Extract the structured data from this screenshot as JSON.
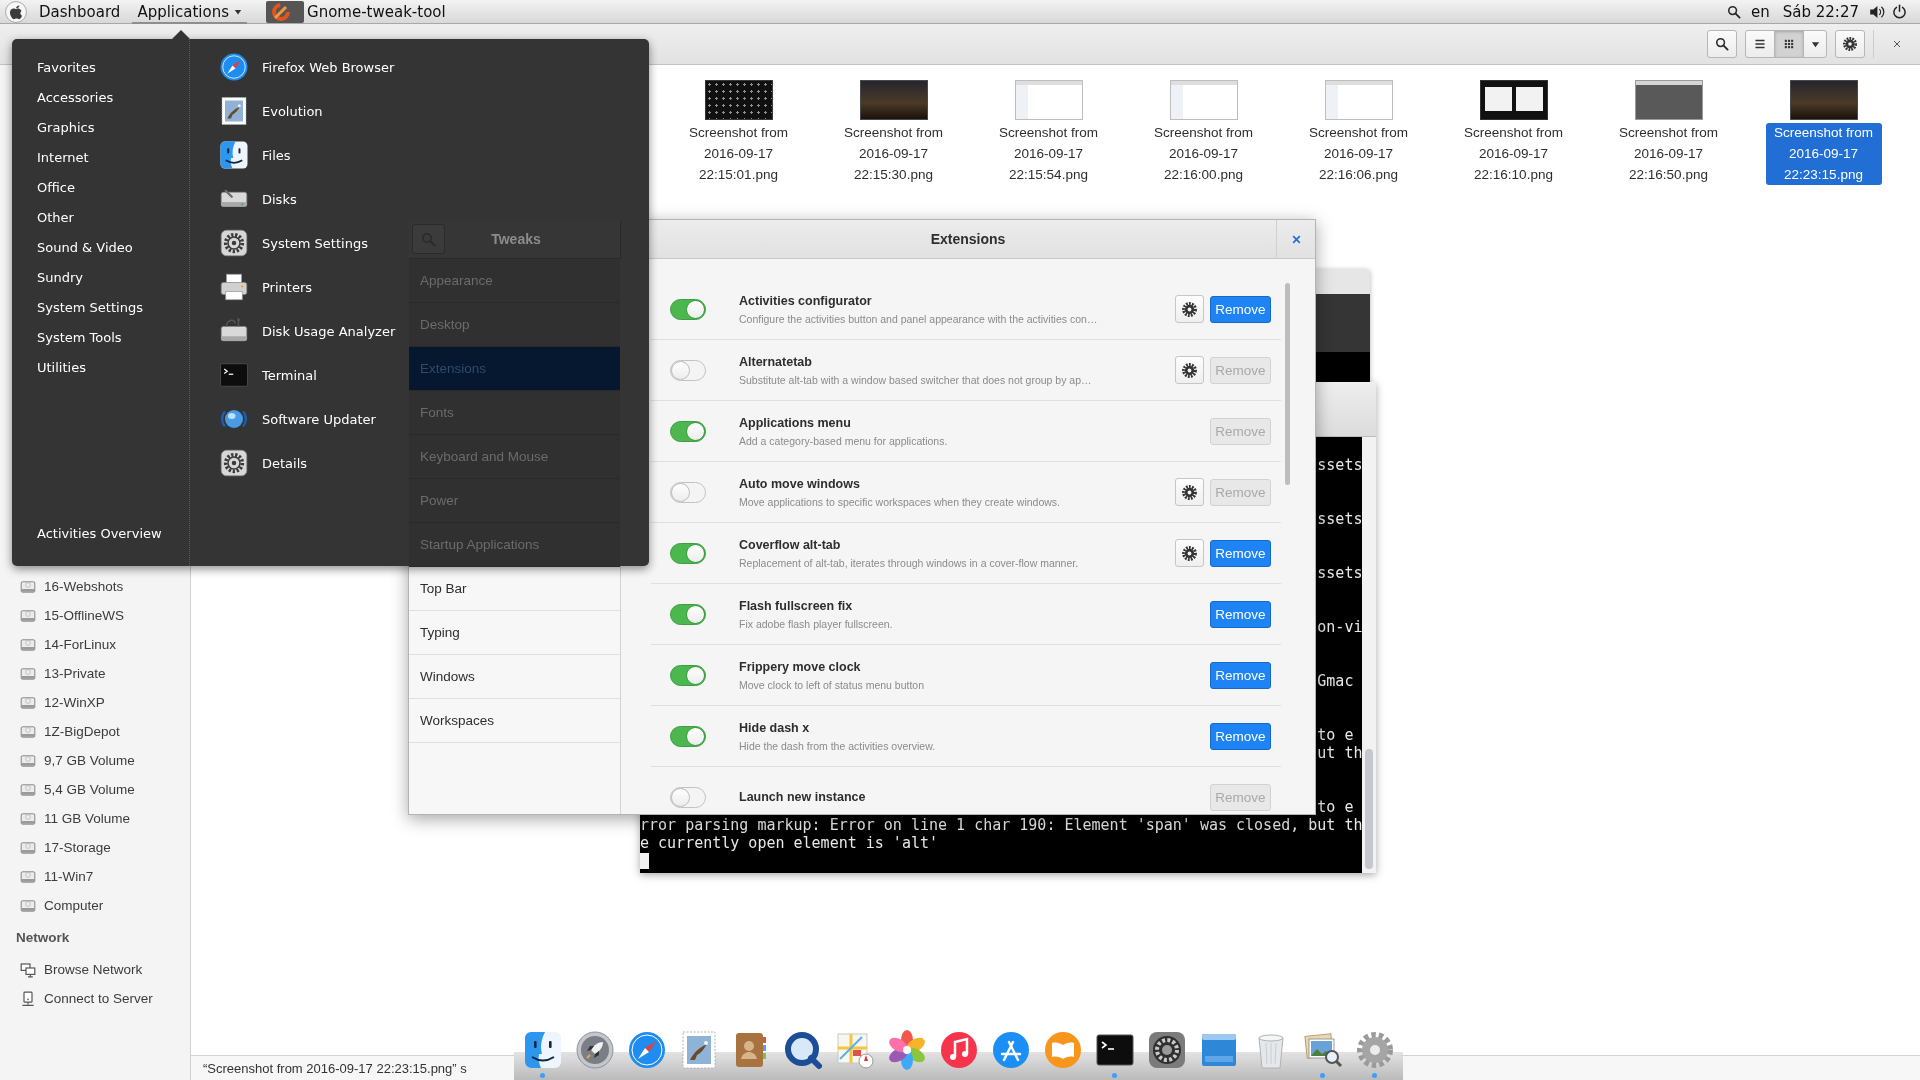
{
  "top_bar": {
    "menus": [
      {
        "label": "Dashboard",
        "selected": false,
        "dropdown": false
      },
      {
        "label": "Applications",
        "selected": true,
        "dropdown": true
      }
    ],
    "window_title": "Gnome-tweak-tool",
    "language": "en",
    "clock": "Sáb 22:27"
  },
  "app_menu": {
    "categories": [
      "Favorites",
      "Accessories",
      "Graphics",
      "Internet",
      "Office",
      "Other",
      "Sound & Video",
      "Sundry",
      "System Settings",
      "System Tools",
      "Utilities"
    ],
    "apps": [
      {
        "label": "Firefox Web Browser",
        "kind": "compass"
      },
      {
        "label": "Evolution",
        "kind": "stamp"
      },
      {
        "label": "Files",
        "kind": "face"
      },
      {
        "label": "Disks",
        "kind": "disk"
      },
      {
        "label": "System Settings",
        "kind": "gear"
      },
      {
        "label": "Printers",
        "kind": "printer"
      },
      {
        "label": "Disk Usage Analyzer",
        "kind": "analyzer"
      },
      {
        "label": "Terminal",
        "kind": "terminal"
      },
      {
        "label": "Software Updater",
        "kind": "globe"
      },
      {
        "label": "Details",
        "kind": "gear"
      }
    ],
    "footer": "Activities Overview"
  },
  "file_manager": {
    "view_buttons": [
      {
        "kind": "list",
        "selected": false
      },
      {
        "kind": "grid",
        "selected": true
      }
    ],
    "devices": [
      "16-Webshots",
      "15-OfflineWS",
      "14-ForLinux",
      "13-Private",
      "12-WinXP",
      "1Z-BigDepot",
      "9,7 GB Volume",
      "5,4 GB Volume",
      "11 GB Volume",
      "17-Storage",
      "11-Win7",
      "Computer"
    ],
    "network_title": "Network",
    "network": [
      {
        "label": "Browse Network",
        "kind": "network"
      },
      {
        "label": "Connect to Server",
        "kind": "server"
      }
    ],
    "files": [
      {
        "name": "Screenshot from 2016-09-17 22:15:01.png",
        "kind": "dark",
        "selected": false
      },
      {
        "name": "Screenshot from 2016-09-17 22:15:30.png",
        "kind": "photo",
        "selected": false
      },
      {
        "name": "Screenshot from 2016-09-17 22:15:54.png",
        "kind": "light",
        "selected": false
      },
      {
        "name": "Screenshot from 2016-09-17 22:16:00.png",
        "kind": "light",
        "selected": false
      },
      {
        "name": "Screenshot from 2016-09-17 22:16:06.png",
        "kind": "light",
        "selected": false
      },
      {
        "name": "Screenshot from 2016-09-17 22:16:10.png",
        "kind": "split",
        "selected": false
      },
      {
        "name": "Screenshot from 2016-09-17 22:16:50.png",
        "kind": "grey",
        "selected": false
      },
      {
        "name": "Screenshot from 2016-09-17 22:23:15.png",
        "kind": "photo",
        "selected": true
      }
    ],
    "status": "“Screenshot from 2016-09-17 22:23:15.png” s"
  },
  "tweak_tool": {
    "sidebar_header": {
      "title": "Tweaks",
      "shaded": true
    },
    "sidebar": [
      {
        "label": "Appearance",
        "selected": false,
        "shaded": true
      },
      {
        "label": "Desktop",
        "selected": false,
        "shaded": true
      },
      {
        "label": "Extensions",
        "selected": true,
        "shaded": true
      },
      {
        "label": "Fonts",
        "selected": false,
        "shaded": true
      },
      {
        "label": "Keyboard and Mouse",
        "selected": false,
        "shaded": true
      },
      {
        "label": "Power",
        "selected": false,
        "shaded": true
      },
      {
        "label": "Startup Applications",
        "selected": false,
        "shaded": true
      },
      {
        "label": "Top Bar",
        "selected": false,
        "shaded": false
      },
      {
        "label": "Typing",
        "selected": false,
        "shaded": false
      },
      {
        "label": "Windows",
        "selected": false,
        "shaded": false
      },
      {
        "label": "Workspaces",
        "selected": false,
        "shaded": false
      }
    ],
    "title": "Extensions",
    "extensions": [
      {
        "name": "Activities configurator",
        "description": "Configure the activities button and panel appearance with the activities con…",
        "enabled": true,
        "settings": true,
        "remove": {
          "label": "Remove",
          "disabled": false
        }
      },
      {
        "name": "Alternatetab",
        "description": "Substitute alt-tab with a window based switcher that does not group by ap…",
        "enabled": false,
        "settings": true,
        "remove": {
          "label": "Remove",
          "disabled": true
        }
      },
      {
        "name": "Applications menu",
        "description": "Add a category-based menu for applications.",
        "enabled": true,
        "settings": false,
        "remove": {
          "label": "Remove",
          "disabled": true
        }
      },
      {
        "name": "Auto move windows",
        "description": "Move applications to specific workspaces when they create windows.",
        "enabled": false,
        "settings": true,
        "remove": {
          "label": "Remove",
          "disabled": true
        }
      },
      {
        "name": "Coverflow alt-tab",
        "description": "Replacement of alt-tab, iterates through windows in a cover-flow manner.",
        "enabled": true,
        "settings": true,
        "remove": {
          "label": "Remove",
          "disabled": false
        }
      },
      {
        "name": "Flash fullscreen fix",
        "description": "Fix adobe flash player fullscreen.",
        "enabled": true,
        "settings": false,
        "remove": {
          "label": "Remove",
          "disabled": false
        }
      },
      {
        "name": "Frippery move clock",
        "description": "Move clock to left of status menu button",
        "enabled": true,
        "settings": false,
        "remove": {
          "label": "Remove",
          "disabled": false
        }
      },
      {
        "name": "Hide dash x",
        "description": "Hide the dash from the activities overview.",
        "enabled": true,
        "settings": false,
        "remove": {
          "label": "Remove",
          "disabled": false
        }
      },
      {
        "name": "Launch new instance",
        "enabled": false,
        "settings": false,
        "remove": {
          "label": "Remove",
          "disabled": true
        }
      }
    ]
  },
  "terminal": {
    "fragments": [
      [
        "ssets"
      ],
      [
        "ssets"
      ],
      [
        "ssets"
      ],
      [
        "on-vi"
      ],
      [
        "Gmac"
      ],
      [
        "to e",
        "ut th"
      ],
      [
        "to e"
      ]
    ],
    "lines": [
      "rror parsing markup: Error on line 1 char 190: Element 'span' was closed, but th",
      "e currently open element is 'alt'"
    ],
    "cursor": true
  },
  "dock": {
    "items": [
      {
        "kind": "face",
        "running": true
      },
      {
        "kind": "rocket",
        "running": false
      },
      {
        "kind": "compass",
        "running": false
      },
      {
        "kind": "stamp",
        "running": false
      },
      {
        "kind": "contacts",
        "running": false
      },
      {
        "kind": "qring",
        "running": false
      },
      {
        "kind": "map",
        "running": false
      },
      {
        "kind": "flower",
        "running": false
      },
      {
        "kind": "music",
        "running": false
      },
      {
        "kind": "letter",
        "running": false
      },
      {
        "kind": "reader",
        "running": false
      },
      {
        "kind": "terminal",
        "running": true
      },
      {
        "kind": "prefs",
        "running": false
      },
      {
        "kind": "window",
        "running": false
      },
      {
        "kind": "trash",
        "running": false
      },
      {
        "kind": "preview",
        "running": true
      },
      {
        "kind": "settings",
        "running": true
      }
    ]
  }
}
